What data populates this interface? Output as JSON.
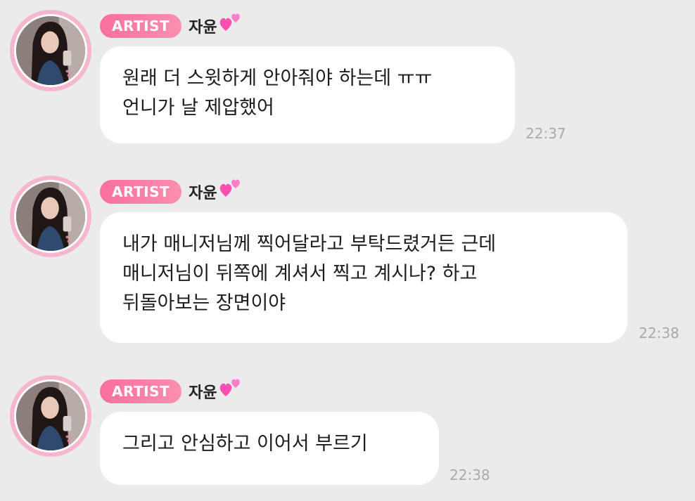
{
  "messages": [
    {
      "badge": "ARTIST",
      "name": "자윤",
      "lines": [
        "원래 더 스윗하게 안아줘야 하는데 ㅠㅠ",
        "언니가 날 제압했어"
      ],
      "time": "22:37"
    },
    {
      "badge": "ARTIST",
      "name": "자윤",
      "lines": [
        "내가 매니저님께 찍어달라고 부탁드렸거든 근데",
        "매니저님이 뒤쪽에 계셔서 찍고 계시나? 하고",
        "뒤돌아보는 장면이야"
      ],
      "time": "22:38"
    },
    {
      "badge": "ARTIST",
      "name": "자윤",
      "lines": [
        "그리고 안심하고 이어서 부르기"
      ],
      "time": "22:38"
    }
  ],
  "colors": {
    "background": "#ebebeb",
    "bubble": "#ffffff",
    "badge": "#f97fa6",
    "avatar_ring": "#f7b6cf",
    "time_text": "#aaaaaa"
  },
  "icons": {
    "heart": "two-hearts-icon"
  }
}
